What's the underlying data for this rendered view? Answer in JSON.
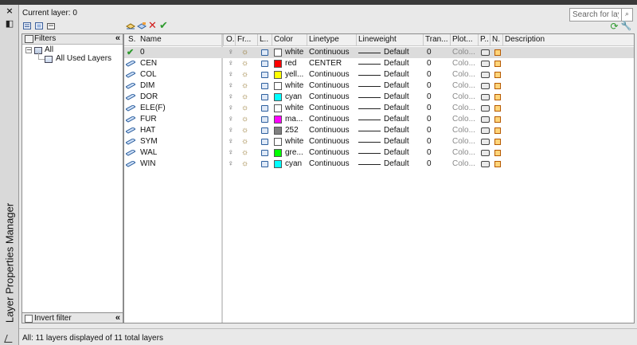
{
  "panel": {
    "title": "Layer Properties Manager",
    "current_layer": "Current layer: 0",
    "search_placeholder": "Search for layer",
    "status_text": "All: 11 layers displayed of 11 total layers"
  },
  "filters": {
    "header": "Filters",
    "root": "All",
    "child": "All Used Layers",
    "invert_label": "Invert filter"
  },
  "columns": [
    "S.",
    "Name",
    "O.",
    "Fr...",
    "L..",
    "Color",
    "Linetype",
    "Lineweight",
    "Tran...",
    "Plot...",
    "P..",
    "N.",
    "Description"
  ],
  "layers": [
    {
      "name": "0",
      "current": true,
      "color_hex": "#ffffff",
      "color_name": "white",
      "linetype": "Continuous",
      "lineweight": "Default",
      "transparency": "0",
      "plot_style": "Colo..."
    },
    {
      "name": "CEN",
      "color_hex": "#ff0000",
      "color_name": "red",
      "linetype": "CENTER",
      "lineweight": "Default",
      "transparency": "0",
      "plot_style": "Colo..."
    },
    {
      "name": "COL",
      "color_hex": "#ffff00",
      "color_name": "yell...",
      "linetype": "Continuous",
      "lineweight": "Default",
      "transparency": "0",
      "plot_style": "Colo..."
    },
    {
      "name": "DIM",
      "color_hex": "#ffffff",
      "color_name": "white",
      "linetype": "Continuous",
      "lineweight": "Default",
      "transparency": "0",
      "plot_style": "Colo..."
    },
    {
      "name": "DOR",
      "color_hex": "#00ffff",
      "color_name": "cyan",
      "linetype": "Continuous",
      "lineweight": "Default",
      "transparency": "0",
      "plot_style": "Colo..."
    },
    {
      "name": "ELE(F)",
      "color_hex": "#ffffff",
      "color_name": "white",
      "linetype": "Continuous",
      "lineweight": "Default",
      "transparency": "0",
      "plot_style": "Colo..."
    },
    {
      "name": "FUR",
      "color_hex": "#ff00ff",
      "color_name": "ma...",
      "linetype": "Continuous",
      "lineweight": "Default",
      "transparency": "0",
      "plot_style": "Colo..."
    },
    {
      "name": "HAT",
      "color_hex": "#808080",
      "color_name": "252",
      "linetype": "Continuous",
      "lineweight": "Default",
      "transparency": "0",
      "plot_style": "Colo..."
    },
    {
      "name": "SYM",
      "color_hex": "#ffffff",
      "color_name": "white",
      "linetype": "Continuous",
      "lineweight": "Default",
      "transparency": "0",
      "plot_style": "Colo..."
    },
    {
      "name": "WAL",
      "color_hex": "#00ff00",
      "color_name": "gre...",
      "linetype": "Continuous",
      "lineweight": "Default",
      "transparency": "0",
      "plot_style": "Colo..."
    },
    {
      "name": "WIN",
      "color_hex": "#00ffff",
      "color_name": "cyan",
      "linetype": "Continuous",
      "lineweight": "Default",
      "transparency": "0",
      "plot_style": "Colo..."
    }
  ],
  "colors": {
    "accent": "#2d5f9e",
    "current_check": "#2e9a2e",
    "delete": "#d11a1a",
    "selected_row": "#dcdcdc"
  }
}
